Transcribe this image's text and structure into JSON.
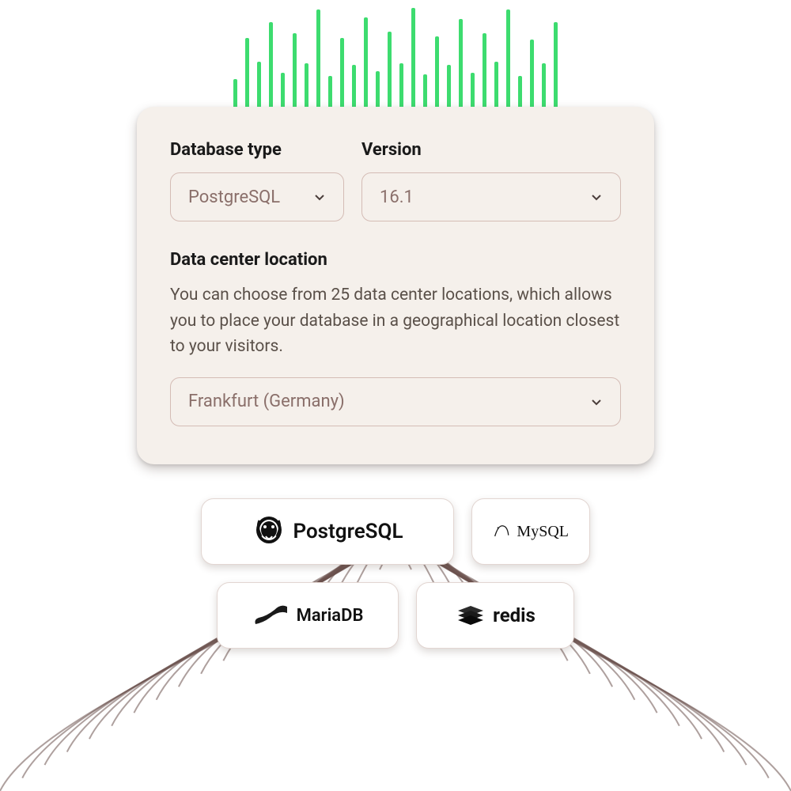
{
  "form": {
    "db_type_label": "Database type",
    "db_type_value": "PostgreSQL",
    "version_label": "Version",
    "version_value": "16.1",
    "location_label": "Data center location",
    "location_desc": "You can choose from 25 data center locations, which allows you to place your database in a geographical location closest to your visitors.",
    "location_value": "Frankfurt (Germany)"
  },
  "db_logos": {
    "postgresql": "PostgreSQL",
    "mysql": "MySQL",
    "mariadb": "MariaDB",
    "redis": "redis"
  },
  "colors": {
    "card_bg": "#f5f0eb",
    "border": "#d4bcb5",
    "accent_green": "#3ddc6f",
    "root_line": "#6b524e"
  },
  "green_bar_heights": [
    40,
    92,
    62,
    112,
    48,
    98,
    60,
    128,
    44,
    92,
    58,
    118,
    50,
    100,
    60,
    130,
    46,
    94,
    58,
    116,
    48,
    98,
    62,
    128,
    44,
    90,
    60,
    112
  ]
}
